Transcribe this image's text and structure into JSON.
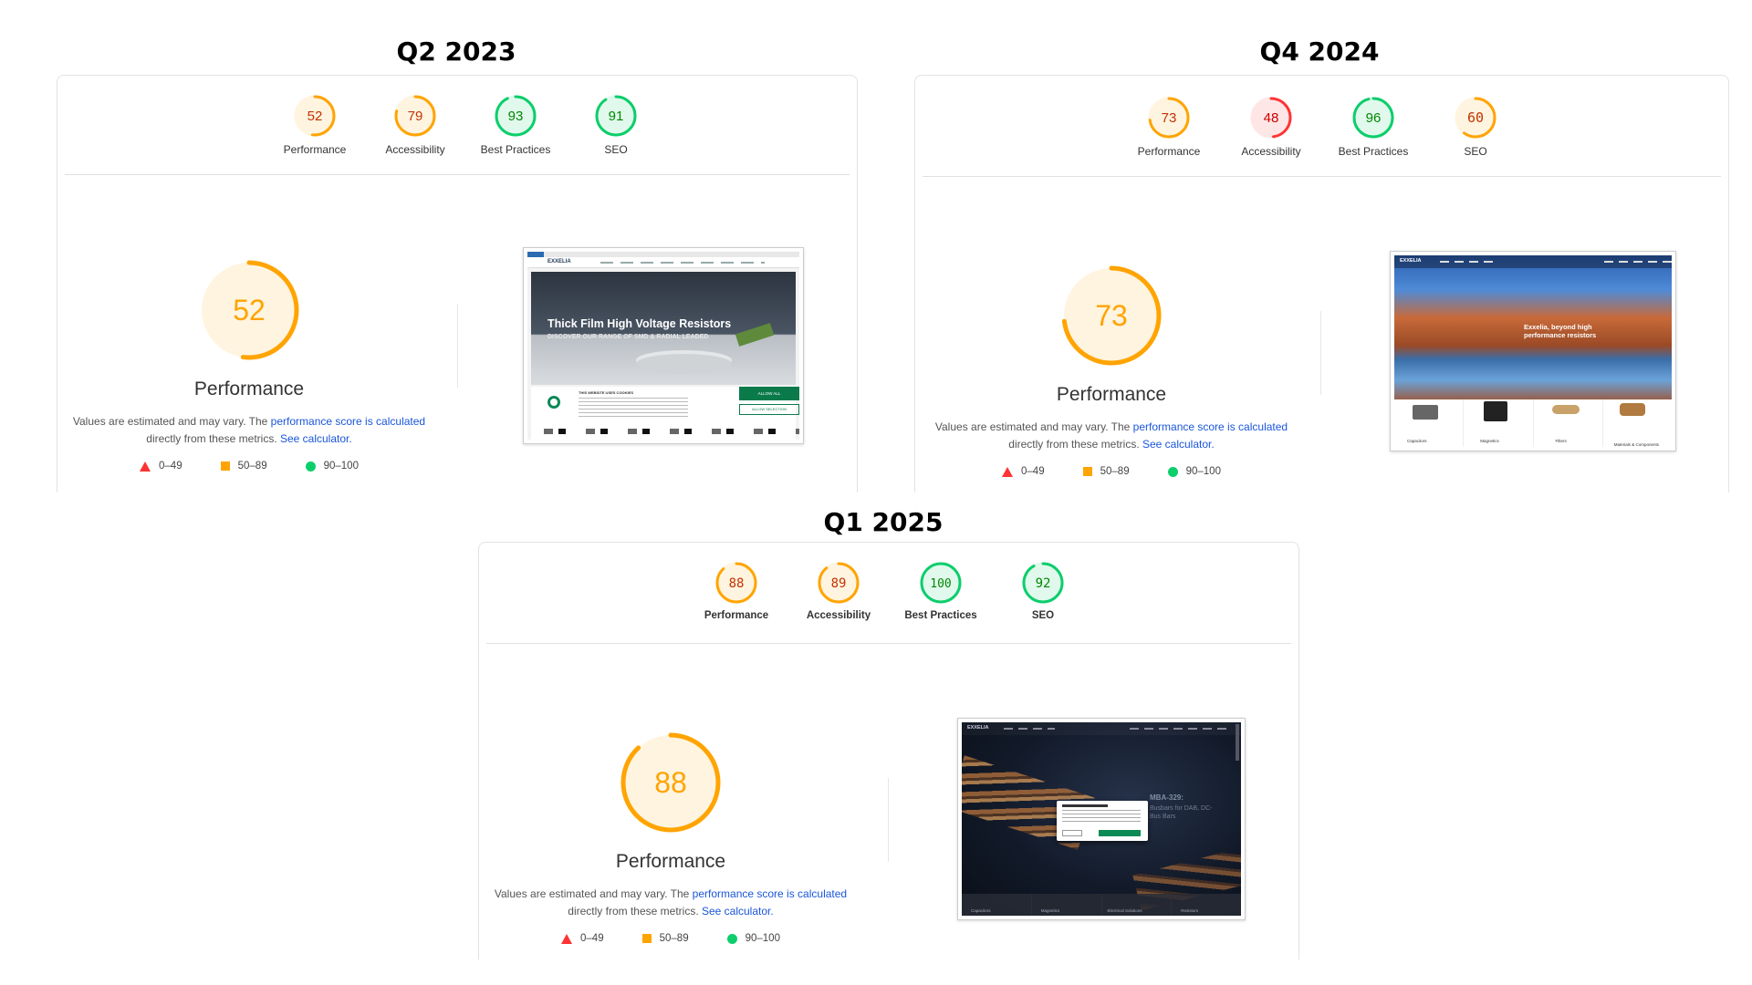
{
  "colors": {
    "pass": "#0cce6b",
    "average": "#ffa400",
    "fail": "#ff3333",
    "link": "#1a56db"
  },
  "legend": [
    {
      "icon": "triangle-red-icon",
      "label": "0–49"
    },
    {
      "icon": "square-orange-icon",
      "label": "50–89"
    },
    {
      "icon": "circle-green-icon",
      "label": "90–100"
    }
  ],
  "reports": [
    {
      "title": "Q2 2023",
      "scores": [
        {
          "label": "Performance",
          "value": 52
        },
        {
          "label": "Accessibility",
          "value": 79
        },
        {
          "label": "Best Practices",
          "value": 93
        },
        {
          "label": "SEO",
          "value": 91
        }
      ],
      "main": {
        "value": 52,
        "label": "Performance"
      },
      "note": {
        "pre": "Values are estimated and may vary. The ",
        "link1": "performance score is calculated",
        "mid": "directly from these metrics. ",
        "link2": "See calculator."
      },
      "preview": {
        "brand": "EXXELIA",
        "headline": "Thick Film High Voltage Resistors",
        "subline": "DISCOVER OUR RANGE OF SMD & RADIAL LEADED",
        "cookie_title": "THIS WEBSITE USES COOKIES",
        "cookie_button": "ALLOW ALL",
        "cookie_button2": "ALLOW SELECTION"
      }
    },
    {
      "title": "Q4 2024",
      "scores": [
        {
          "label": "Performance",
          "value": 73
        },
        {
          "label": "Accessibility",
          "value": 48
        },
        {
          "label": "Best Practices",
          "value": 96
        },
        {
          "label": "SEO",
          "value": 60
        }
      ],
      "main": {
        "value": 73,
        "label": "Performance"
      },
      "note": {
        "pre": "Values are estimated and may vary. The ",
        "link1": "performance score is calculated",
        "mid": "directly from these metrics. ",
        "link2": "See calculator."
      },
      "preview": {
        "brand": "EXXELIA",
        "headline": "Exxelia, beyond high performance resistors",
        "categories": [
          "Capacitors",
          "Magnetics",
          "Filters",
          "Materials & Components"
        ]
      }
    },
    {
      "title": "Q1 2025",
      "scores": [
        {
          "label": "Performance",
          "value": 88
        },
        {
          "label": "Accessibility",
          "value": 89
        },
        {
          "label": "Best Practices",
          "value": 100
        },
        {
          "label": "SEO",
          "value": 92
        }
      ],
      "main": {
        "value": 88,
        "label": "Performance"
      },
      "note": {
        "pre": "Values are estimated and may vary. The ",
        "link1": "performance score is calculated",
        "mid": "directly from these metrics. ",
        "link2": "See calculator."
      },
      "preview": {
        "brand": "EXXELIA",
        "headline": "MBA-329:",
        "subline": "Busbars for DAB, DC-Bus Bars",
        "categories": [
          "Capacitors",
          "Magnetics",
          "Electrical Solutions",
          "Resistors"
        ]
      }
    }
  ]
}
